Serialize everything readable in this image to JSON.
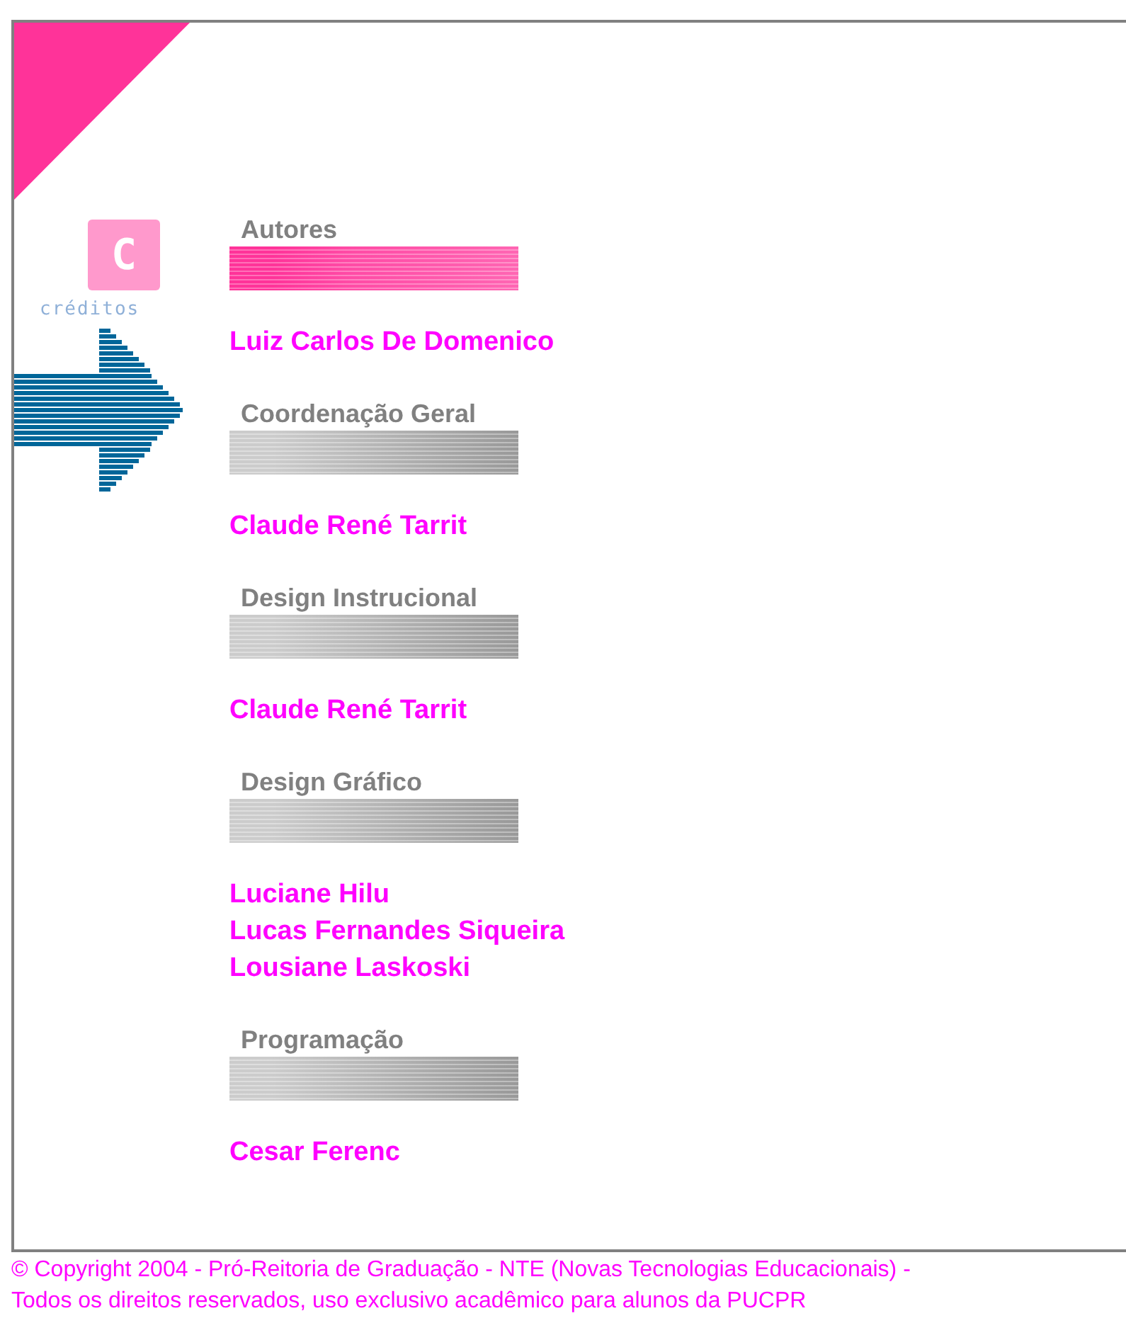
{
  "logo": {
    "letter": "C",
    "caption": "créditos"
  },
  "sections": [
    {
      "heading": "Autores",
      "highlighted": true,
      "names": [
        "Luiz Carlos De Domenico"
      ]
    },
    {
      "heading": "Coordenação Geral",
      "highlighted": false,
      "names": [
        "Claude René Tarrit"
      ]
    },
    {
      "heading": "Design Instrucional",
      "highlighted": false,
      "names": [
        "Claude René Tarrit"
      ]
    },
    {
      "heading": "Design Gráfico",
      "highlighted": false,
      "names": [
        "Luciane Hilu",
        "Lucas Fernandes Siqueira",
        "Lousiane Laskoski"
      ]
    },
    {
      "heading": "Programação",
      "highlighted": false,
      "names": [
        "Cesar Ferenc"
      ]
    }
  ],
  "footer": [
    "© Copyright 2004 - Pró-Reitoria de Graduação - NTE (Novas Tecnologias Educacionais) -",
    "Todos os direitos reservados, uso exclusivo acadêmico para alunos da PUCPR"
  ]
}
